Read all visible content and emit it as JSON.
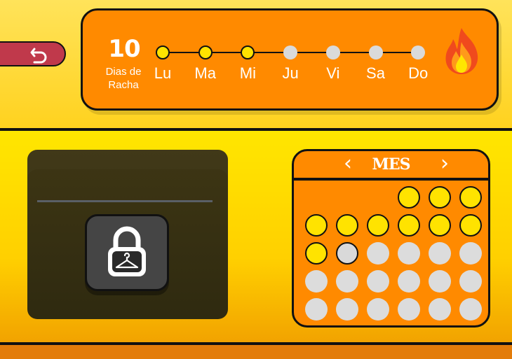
{
  "streak": {
    "count": "10",
    "label_line1": "Dias de",
    "label_line2": "Racha",
    "days": [
      {
        "label": "Lu",
        "completed": true
      },
      {
        "label": "Ma",
        "completed": true
      },
      {
        "label": "Mi",
        "completed": true
      },
      {
        "label": "Ju",
        "completed": false
      },
      {
        "label": "Vi",
        "completed": false
      },
      {
        "label": "Sa",
        "completed": false
      },
      {
        "label": "Do",
        "completed": false
      }
    ],
    "icon": "flame-icon"
  },
  "navigation": {
    "back_icon": "back-arrow-icon"
  },
  "wardrobe": {
    "locked": true,
    "icon": "lock-hanger-icon"
  },
  "calendar": {
    "title": "MES",
    "prev_label": "‹",
    "next_label": "›",
    "leading_blank_cells": 3,
    "days": [
      "done",
      "done",
      "done",
      "done",
      "done",
      "done",
      "done",
      "done",
      "done",
      "done",
      "today",
      "todo",
      "todo",
      "todo",
      "todo",
      "todo",
      "todo",
      "todo",
      "todo",
      "todo",
      "todo",
      "todo",
      "todo",
      "todo",
      "todo",
      "todo",
      "todo"
    ]
  },
  "colors": {
    "accent_orange": "#ff8a00",
    "completed_yellow": "#ffe300",
    "pending_gray": "#dadada",
    "back_button_red": "#c0394b"
  }
}
